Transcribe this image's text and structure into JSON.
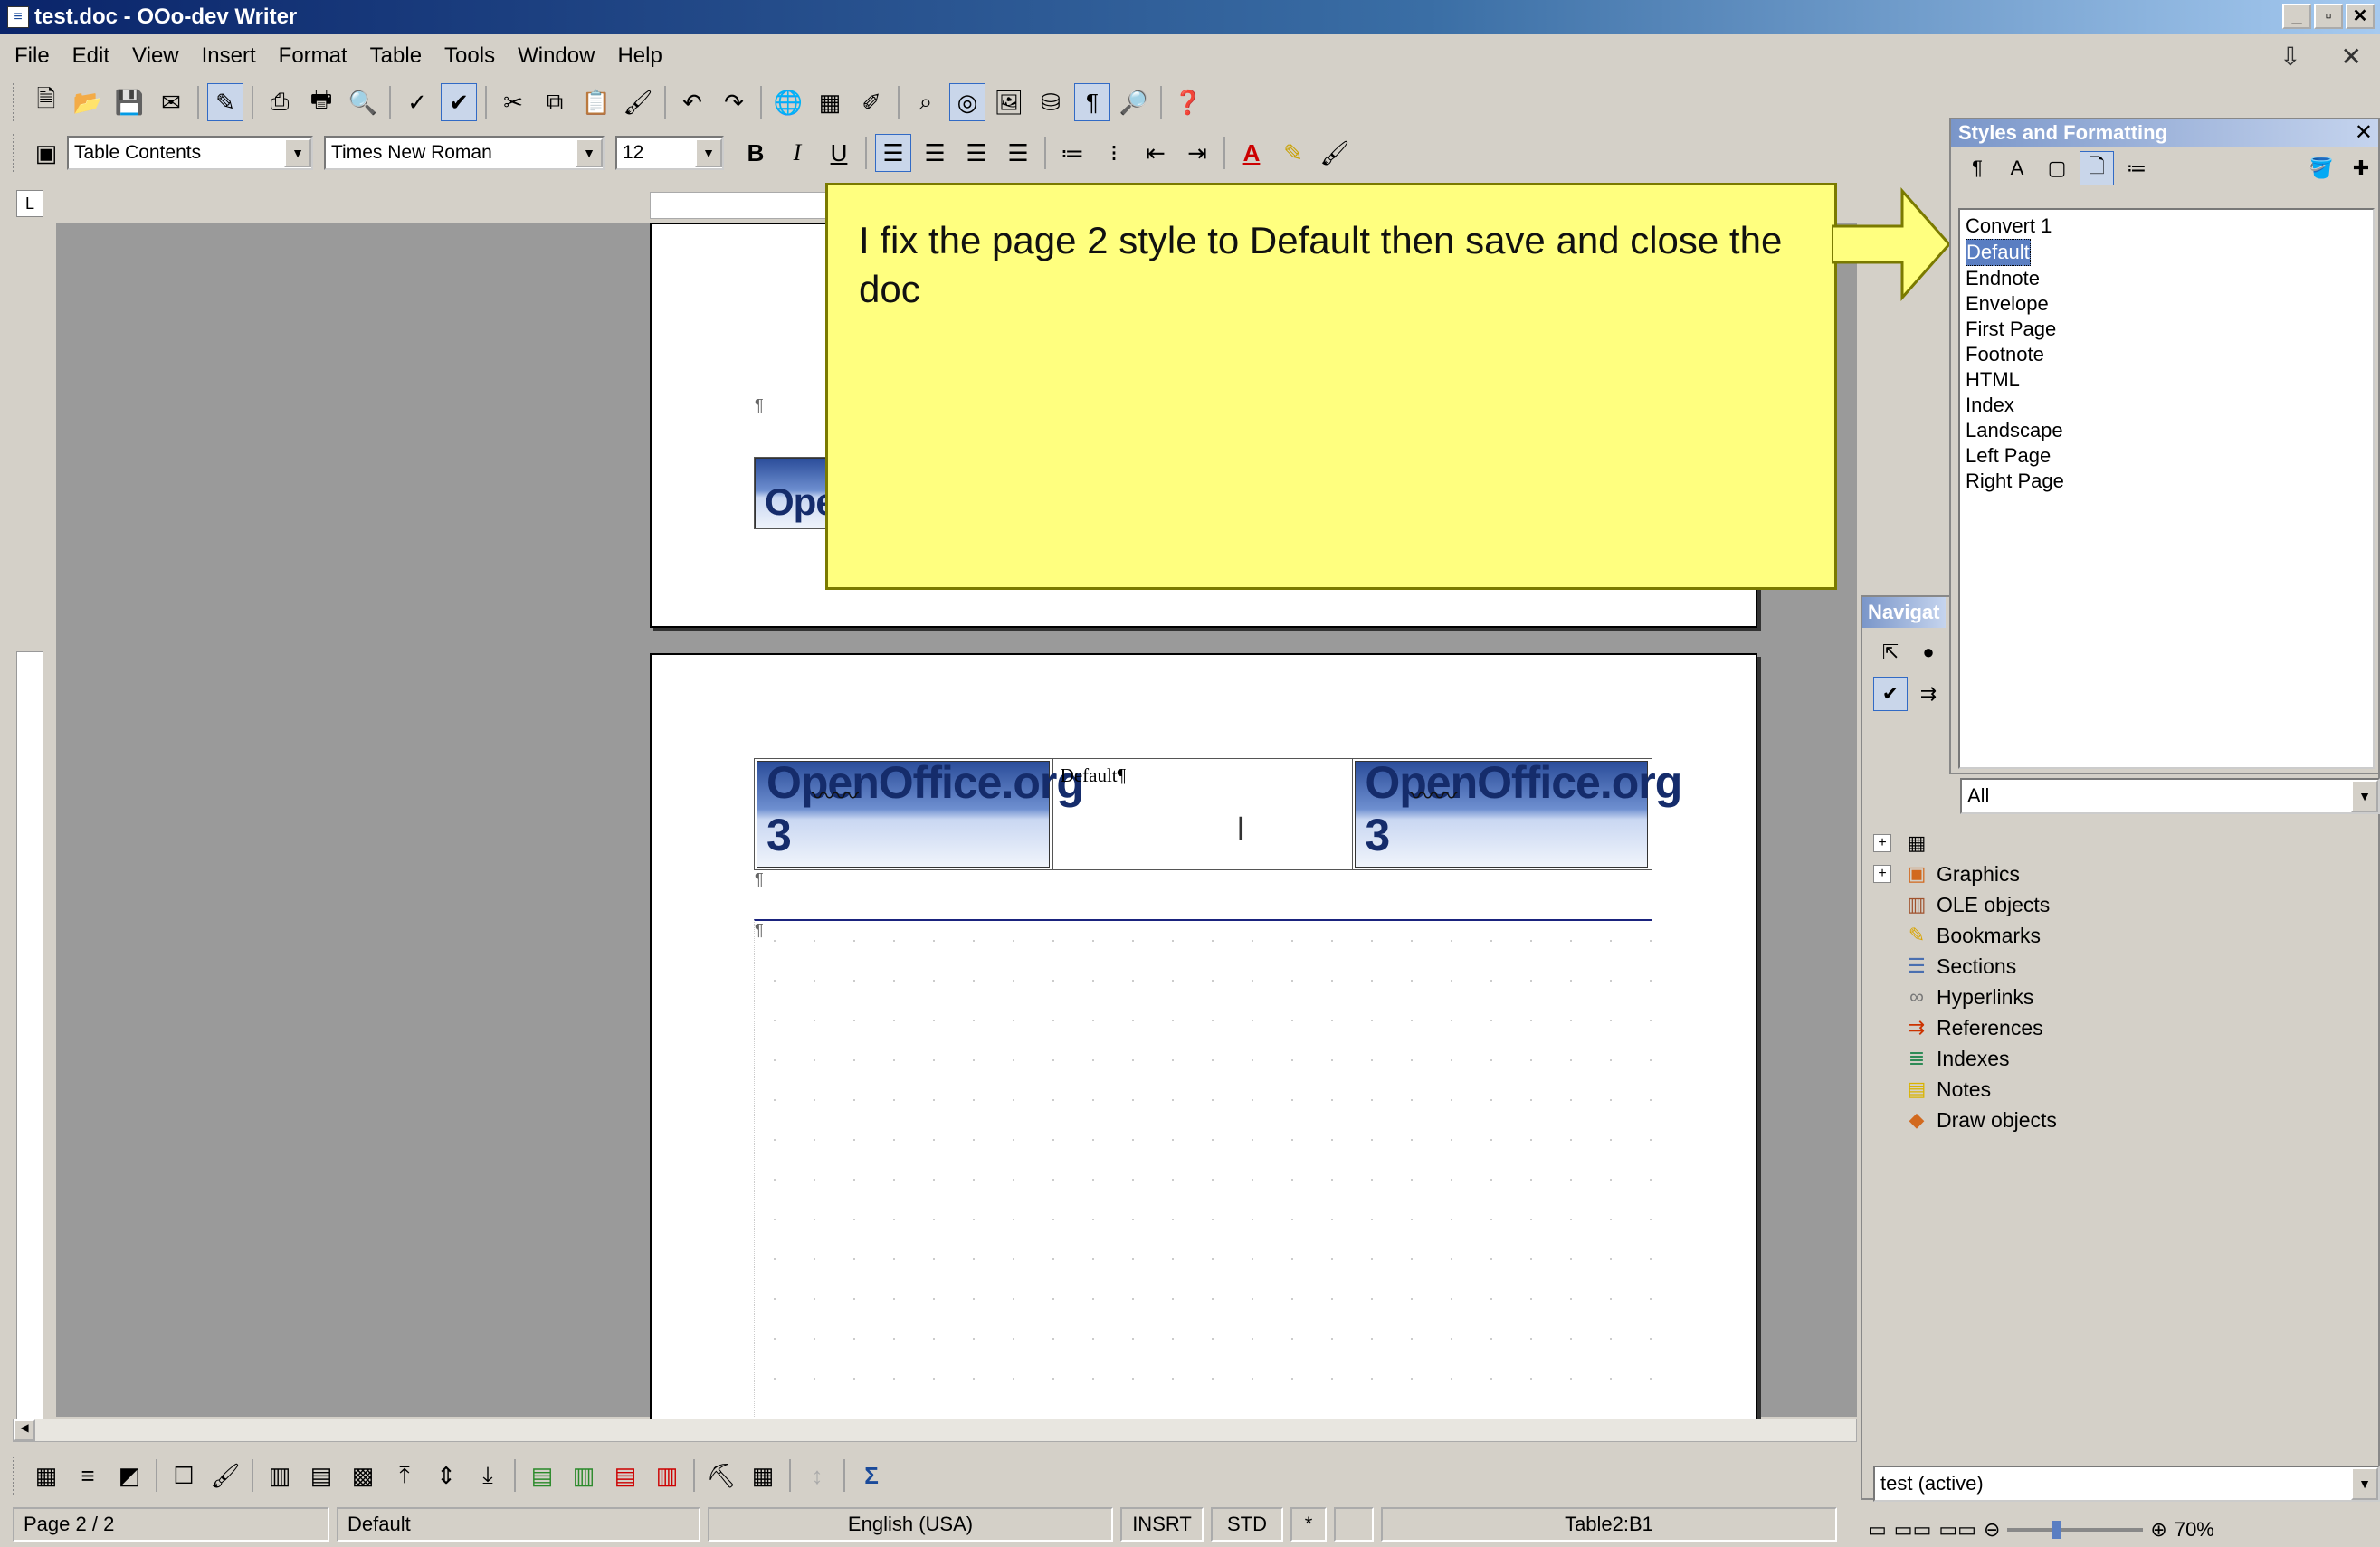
{
  "window": {
    "title": "test.doc - OOo-dev Writer",
    "minimize": "_",
    "maximize": "▫",
    "close": "✕"
  },
  "menu": [
    "File",
    "Edit",
    "View",
    "Insert",
    "Format",
    "Table",
    "Tools",
    "Window",
    "Help"
  ],
  "formatting": {
    "paragraph_style": "Table Contents",
    "font_name": "Times New Roman",
    "font_size": "12"
  },
  "document": {
    "cell_text": "Default",
    "logo_text": "OpenOffice.org 3",
    "partial_logo_text": "Ope",
    "pilcrow": "¶"
  },
  "callout": {
    "text": "I fix the page 2 style to Default then save and close the doc"
  },
  "styles_panel": {
    "title": "Styles and Formatting",
    "items": [
      "Convert 1",
      "Default",
      "Endnote",
      "Envelope",
      "First Page",
      "Footnote",
      "HTML",
      "Index",
      "Landscape",
      "Left Page",
      "Right Page"
    ],
    "selected": "Default",
    "filter": "All"
  },
  "navigator": {
    "title": "Navigat",
    "items": [
      {
        "label": "Graphics",
        "icon": "graphics-icon",
        "glyph": "▣",
        "color": "#d2691e",
        "expandable": true
      },
      {
        "label": "OLE objects",
        "icon": "ole-objects-icon",
        "glyph": "▥",
        "color": "#a0522d",
        "expandable": false
      },
      {
        "label": "Bookmarks",
        "icon": "bookmark-icon",
        "glyph": "✎",
        "color": "#d9a400",
        "expandable": false
      },
      {
        "label": "Sections",
        "icon": "sections-icon",
        "glyph": "☰",
        "color": "#4a6fb0",
        "expandable": false
      },
      {
        "label": "Hyperlinks",
        "icon": "hyperlinks-icon",
        "glyph": "∞",
        "color": "#777777",
        "expandable": false
      },
      {
        "label": "References",
        "icon": "references-icon",
        "glyph": "⇉",
        "color": "#cc3300",
        "expandable": false
      },
      {
        "label": "Indexes",
        "icon": "indexes-icon",
        "glyph": "≣",
        "color": "#2e8b57",
        "expandable": false
      },
      {
        "label": "Notes",
        "icon": "notes-icon",
        "glyph": "▤",
        "color": "#d9b300",
        "expandable": false
      },
      {
        "label": "Draw objects",
        "icon": "draw-objects-icon",
        "glyph": "◆",
        "color": "#d2691e",
        "expandable": false
      }
    ],
    "document": "test (active)"
  },
  "status": {
    "page": "Page 2 / 2",
    "page_style": "Default",
    "language": "English (USA)",
    "insert_mode": "INSRT",
    "selection_mode": "STD",
    "modified": "*",
    "cell": "Table2:B1",
    "zoom": "70%"
  },
  "colors": {
    "callout_bg": "#ffff7f",
    "title_bar": "#0a246a",
    "selection": "#5a7ec2"
  }
}
